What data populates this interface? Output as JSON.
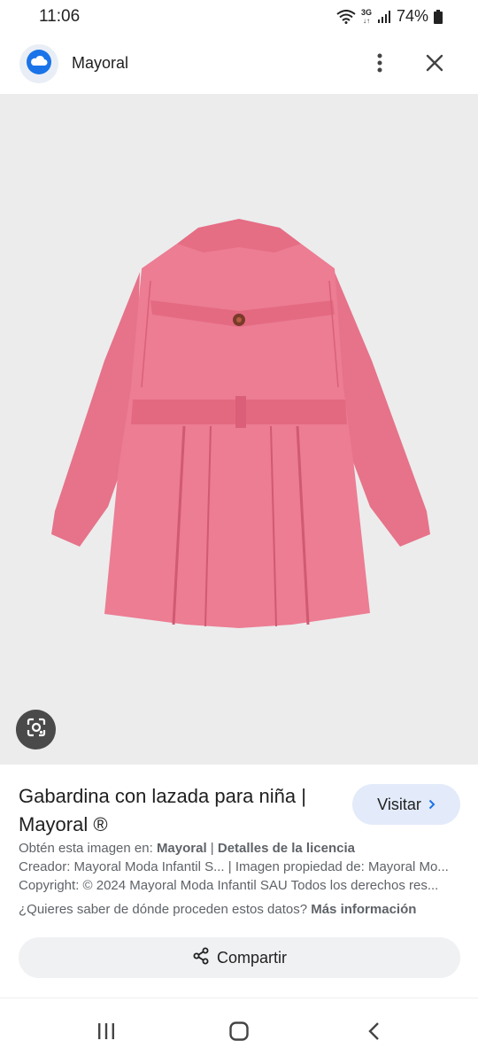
{
  "status": {
    "time": "11:06",
    "network": "3G",
    "battery": "74%"
  },
  "header": {
    "site_name": "Mayoral",
    "logo_icon": "cloud-icon",
    "more_icon": "more-vert-icon",
    "close_icon": "close-icon"
  },
  "image": {
    "subject": "pink-trench-coat",
    "background": "#ececed",
    "lens_icon": "google-lens-icon"
  },
  "result": {
    "title": "Gabardina con lazada para niña | Mayoral ®",
    "visit_label": "Visitar",
    "source_prefix": "Obtén esta imagen en: ",
    "source_site": "Mayoral",
    "separator": " | ",
    "license_link": "Detalles de la licencia",
    "creator": "Creador: Mayoral Moda Infantil S... | Imagen propiedad de: Mayoral Mo...",
    "copyright": "Copyright: © 2024 Mayoral Moda Infantil SAU Todos los derechos res...",
    "question": "¿Quieres saber de dónde proceden estos datos? ",
    "more_info_link": "Más información",
    "share_label": "Compartir"
  },
  "colors": {
    "accent": "#1a73e8",
    "visit_bg": "#e3ebfa",
    "share_bg": "#f0f1f3",
    "coat_pink": "#e8748a"
  }
}
